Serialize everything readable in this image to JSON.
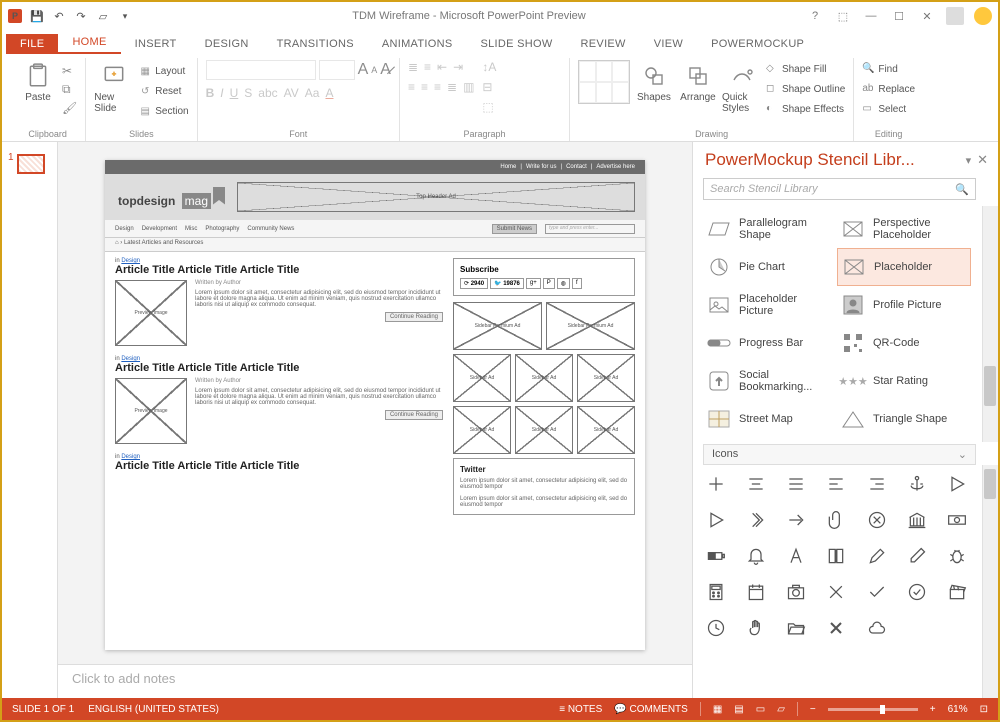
{
  "window": {
    "title": "TDM Wireframe - Microsoft PowerPoint Preview"
  },
  "tabs": {
    "file": "FILE",
    "home": "HOME",
    "insert": "INSERT",
    "design": "DESIGN",
    "transitions": "TRANSITIONS",
    "animations": "ANIMATIONS",
    "slideshow": "SLIDE SHOW",
    "review": "REVIEW",
    "view": "VIEW",
    "powermockup": "POWERMOCKUP"
  },
  "ribbon": {
    "clipboard": {
      "paste": "Paste",
      "label": "Clipboard"
    },
    "slides": {
      "new_slide": "New Slide",
      "layout": "Layout",
      "reset": "Reset",
      "section": "Section",
      "label": "Slides"
    },
    "font": {
      "label": "Font"
    },
    "paragraph": {
      "label": "Paragraph"
    },
    "drawing": {
      "shapes": "Shapes",
      "arrange": "Arrange",
      "quick_styles": "Quick Styles",
      "shape_fill": "Shape Fill",
      "shape_outline": "Shape Outline",
      "shape_effects": "Shape Effects",
      "label": "Drawing"
    },
    "editing": {
      "find": "Find",
      "replace": "Replace",
      "select": "Select",
      "label": "Editing"
    }
  },
  "thumb": {
    "num": "1"
  },
  "slide": {
    "top_links": {
      "home": "Home",
      "write": "Write for us",
      "contact": "Contact",
      "advertise": "Advertise here"
    },
    "logo_a": "topdesign",
    "logo_b": "mag",
    "banner": "Top Header Ad",
    "nav": {
      "design": "Design",
      "development": "Development",
      "misc": "Misc",
      "photography": "Photography",
      "community": "Community News",
      "submit": "Submit News",
      "placeholder": "type and press enter..."
    },
    "breadcrumb": "Latest Articles and Resources",
    "article": {
      "cat_in": "in ",
      "cat_link": "Design",
      "title": "Article Title Article Title Article Title",
      "author": "Written by Author",
      "preview": "Preview Image",
      "body": "Lorem ipsum dolor sit amet, consectetur adipisicing elit, sed do eiusmod tempor incididunt ut labore et dolore magna aliqua. Ut enim ad minim veniam, quis nostrud exercitation ullamco laboris nisi ut aliquip ex commodo consequat.",
      "continue": "Continue Reading"
    },
    "subscribe": {
      "title": "Subscribe",
      "rss": "2940",
      "twitter": "19876"
    },
    "ads": {
      "premium": "Sidebar Premium Ad",
      "small": "Sidebar Ad"
    },
    "twitter": {
      "title": "Twitter",
      "body": "Lorem ipsum dolor sit amet, consectetur adipisicing elit, sed do eiusmod tempor\n\nLorem ipsum dolor sit amet, consectetur adipisicing elit, sed do eiusmod tempor"
    }
  },
  "notes": {
    "placeholder": "Click to add notes"
  },
  "stencil": {
    "title": "PowerMockup Stencil Libr...",
    "search_placeholder": "Search Stencil Library",
    "items": {
      "parallelogram": "Parallelogram Shape",
      "perspective": "Perspective Placeholder",
      "pie": "Pie Chart",
      "placeholder": "Placeholder",
      "picture": "Placeholder Picture",
      "profile": "Profile Picture",
      "progress": "Progress Bar",
      "qr": "QR-Code",
      "social": "Social Bookmarking...",
      "star": "Star Rating",
      "street": "Street Map",
      "triangle": "Triangle Shape"
    },
    "icons_header": "Icons"
  },
  "status": {
    "slide": "SLIDE 1 OF 1",
    "lang": "ENGLISH (UNITED STATES)",
    "notes": "NOTES",
    "comments": "COMMENTS",
    "zoom": "61%"
  }
}
